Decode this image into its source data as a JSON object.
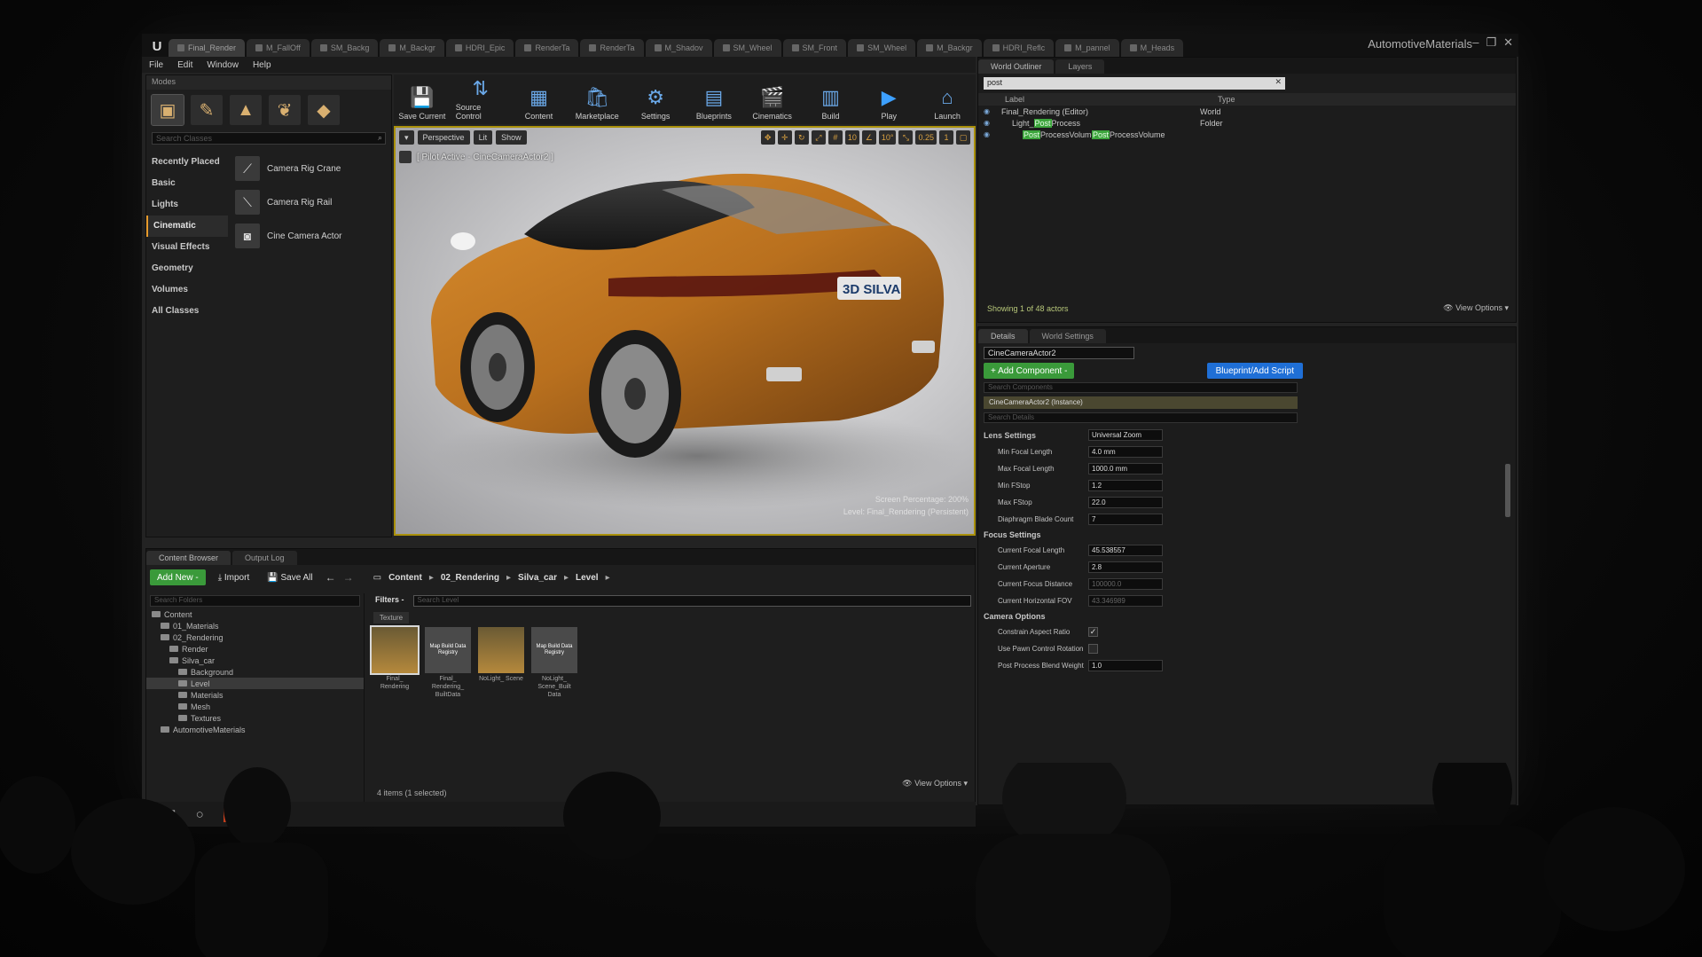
{
  "window": {
    "title": "AutomotiveMaterials",
    "tabs": [
      "Final_Render",
      "M_FallOff",
      "SM_Backg",
      "M_Backgr",
      "HDRI_Epic",
      "RenderTa",
      "RenderTa",
      "M_Shadov",
      "SM_Wheel",
      "SM_Front",
      "SM_Wheel",
      "M_Backgr",
      "HDRI_Reflc",
      "M_pannel",
      "M_Heads"
    ],
    "controls": [
      "–",
      "❐",
      "✕"
    ]
  },
  "menu": [
    "File",
    "Edit",
    "Window",
    "Help"
  ],
  "modes": {
    "header": "Modes",
    "search_placeholder": "Search Classes",
    "categories": [
      "Recently Placed",
      "Basic",
      "Lights",
      "Cinematic",
      "Visual Effects",
      "Geometry",
      "Volumes",
      "All Classes"
    ],
    "selected_category": "Cinematic",
    "classes": [
      "Camera Rig Crane",
      "Camera Rig Rail",
      "Cine Camera Actor"
    ]
  },
  "toolbar": {
    "buttons": [
      "Save Current",
      "Source Control",
      "Content",
      "Marketplace",
      "Settings",
      "Blueprints",
      "Cinematics",
      "Build",
      "Play",
      "Launch"
    ]
  },
  "viewport": {
    "perspective": "Perspective",
    "lit": "Lit",
    "show": "Show",
    "pilot_label": "[ Pilot Active - CineCameraActor2 ]",
    "grid_snap": "10",
    "angle_snap": "10°",
    "scale_snap": "0.25",
    "cam_speed": "1",
    "stat_line1": "Screen Percentage: 200%",
    "stat_line2": "Level:  Final_Rendering (Persistent)",
    "plate_text": "3D SILVA"
  },
  "outliner": {
    "tabs": [
      "World Outliner",
      "Layers"
    ],
    "search_value": "post",
    "columns": [
      "Label",
      "Type"
    ],
    "rows": [
      {
        "label": "Final_Rendering (Editor)",
        "type": "World"
      },
      {
        "label_pre": "Light_",
        "label_hl": "Post",
        "label_post": "Process",
        "type": "Folder"
      },
      {
        "label_hl": "Post",
        "label_post": "ProcessVolume",
        "type_hl": "Post",
        "type_post": "ProcessVolume"
      }
    ],
    "footer": "Showing 1 of 48 actors",
    "view_options": "View Options"
  },
  "details": {
    "tabs": [
      "Details",
      "World Settings"
    ],
    "actor_name": "CineCameraActor2",
    "add_component": "+ Add Component -",
    "blueprint_script": "Blueprint/Add Script",
    "search_components": "Search Components",
    "instance_label": "CineCameraActor2 (Instance)",
    "search_details": "Search Details",
    "lens_section": "Lens Settings",
    "lens_preset": "Universal Zoom",
    "lens_rows": [
      {
        "label": "Min Focal Length",
        "value": "4.0 mm"
      },
      {
        "label": "Max Focal Length",
        "value": "1000.0 mm"
      },
      {
        "label": "Min FStop",
        "value": "1.2"
      },
      {
        "label": "Max FStop",
        "value": "22.0"
      },
      {
        "label": "Diaphragm Blade Count",
        "value": "7"
      }
    ],
    "focus_section": "Focus Settings",
    "current_rows": [
      {
        "label": "Current Focal Length",
        "value": "45.538557"
      },
      {
        "label": "Current Aperture",
        "value": "2.8"
      },
      {
        "label": "Current Focus Distance",
        "value": "100000.0"
      },
      {
        "label": "Current Horizontal FOV",
        "value": "43.346989"
      }
    ],
    "camera_section": "Camera Options",
    "camera_rows": [
      {
        "label": "Constrain Aspect Ratio",
        "checked": true
      },
      {
        "label": "Use Pawn Control Rotation",
        "checked": false
      }
    ],
    "post_blend_label": "Post Process Blend Weight",
    "post_blend_value": "1.0"
  },
  "content_browser": {
    "tabs": [
      "Content Browser",
      "Output Log"
    ],
    "add_new": "Add New -",
    "import": "Import",
    "save_all": "Save All",
    "breadcrumbs": [
      "Content",
      "02_Rendering",
      "Silva_car",
      "Level"
    ],
    "search_folders": "Search Folders",
    "tree": [
      {
        "label": "Content",
        "depth": 0
      },
      {
        "label": "01_Materials",
        "depth": 1
      },
      {
        "label": "02_Rendering",
        "depth": 1
      },
      {
        "label": "Render",
        "depth": 2
      },
      {
        "label": "Silva_car",
        "depth": 2
      },
      {
        "label": "Background",
        "depth": 3
      },
      {
        "label": "Level",
        "depth": 3
      },
      {
        "label": "Materials",
        "depth": 3
      },
      {
        "label": "Mesh",
        "depth": 3
      },
      {
        "label": "Textures",
        "depth": 3
      },
      {
        "label": "AutomotiveMaterials",
        "depth": 1
      }
    ],
    "selected_folder": "Level",
    "filters": "Filters -",
    "search_level": "Search Level",
    "type_badge": "Texture",
    "assets": [
      {
        "name": "Final_ Rendering",
        "thumb": "",
        "kind": "level"
      },
      {
        "name": "Final_ Rendering_ BuiltData",
        "thumb": "Map Build Data Registry",
        "kind": "data"
      },
      {
        "name": "NoLight_ Scene",
        "thumb": "",
        "kind": "level"
      },
      {
        "name": "NoLight_ Scene_Built Data",
        "thumb": "Map Build Data Registry",
        "kind": "data"
      }
    ],
    "count": "4 items (1 selected)",
    "view_options": "View Options"
  },
  "taskbar": {
    "start": "⊞",
    "search": "○",
    "ppt": "P",
    "ue": "U"
  }
}
